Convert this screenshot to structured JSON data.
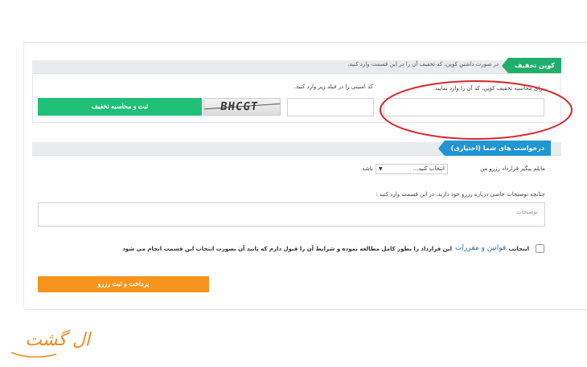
{
  "coupon": {
    "tab_label": "کوپن تخفیف",
    "header_hint": "در صورت داشتن کوپن، کد تخفیف آن را در این قسمت وارد کنید.",
    "coupon_label": "برای محاسبه تخفیف کوپن، کد آن را وارد نمایید.",
    "security_label": "کد امنیتی را در فیلد زیر وارد کنید.",
    "captcha_text": "BHCGT",
    "submit_label": "ثبت و محاسبه تخفیف"
  },
  "requests": {
    "tab_label": "درخواست های شما (اختیاری)",
    "pickup_prefix": "مایلم پیگیر قرارداد رزرو من",
    "pickup_select": "انتخاب کنید...",
    "pickup_suffix": "باشد.",
    "notes_label": "چنانچه توضیحات خاصی درباره رزرو خود دارید، در این قسمت وارد کنید :",
    "notes_placeholder": "توضیحات"
  },
  "terms": {
    "prefix": "اینجانب",
    "link": "قوانین و مقررات",
    "suffix": "این قرارداد را بطور کامل مطالعه نموده و شرایط آن را قبول دارم که تایید آن بصورت انتخاب این قسمت انجام می شود"
  },
  "pay_button": "پرداخت و ثبت رزرو",
  "logo_text": "ال گشت",
  "colors": {
    "green": "#1ec078",
    "blue_tab": "#2196d3",
    "orange": "#f7941d",
    "annotation": "#d9262c"
  }
}
